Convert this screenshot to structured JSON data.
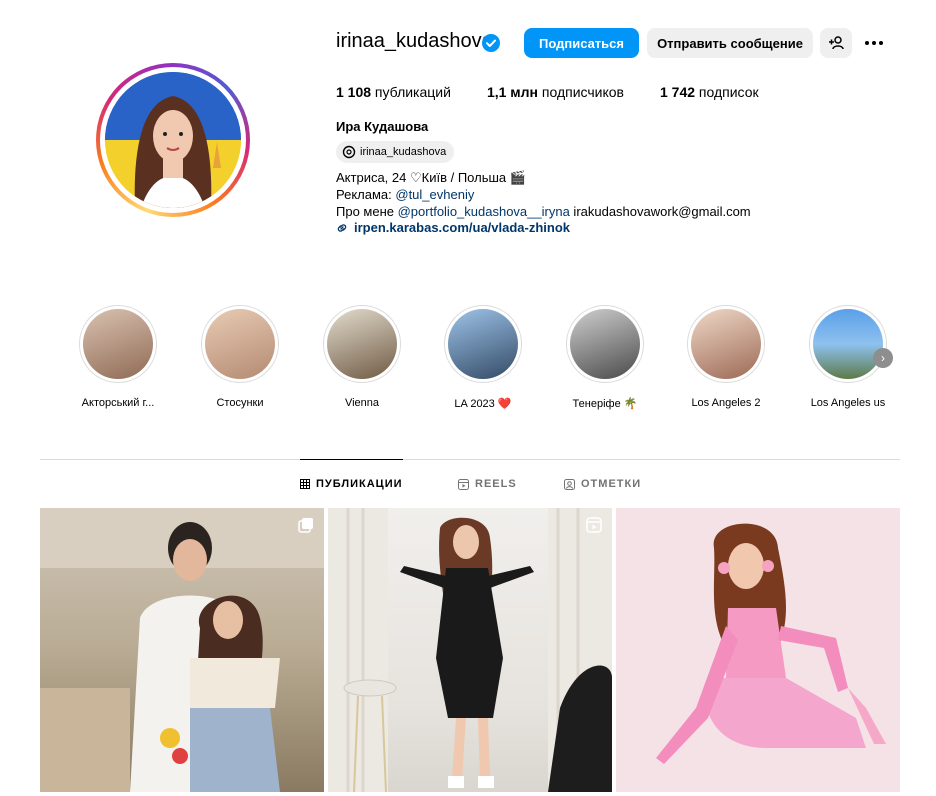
{
  "profile": {
    "username": "irinaa_kudashova",
    "full_name": "Ира Кудашова",
    "threads_handle": "irinaa_kudashova",
    "bio": {
      "line1": "Актриса, 24 ♡Київ / Польша 🎬",
      "line2_prefix": "Реклама: ",
      "line2_link": "@tul_evheniy",
      "line3_prefix": "Про мене ",
      "line3_link": "@portfolio_kudashova__iryna",
      "line3_suffix": " irakudashovawork@gmail.com"
    },
    "external_link": "irpen.karabas.com/ua/vlada-zhinok"
  },
  "actions": {
    "follow_label": "Подписаться",
    "message_label": "Отправить сообщение"
  },
  "stats": {
    "posts_count": "1 108",
    "posts_label": " публикаций",
    "followers_count": "1,1 млн",
    "followers_label": " подписчиков",
    "following_count": "1 742",
    "following_label": " подписок"
  },
  "highlights": [
    {
      "label": "Акторський г..."
    },
    {
      "label": "Стосунки"
    },
    {
      "label": "Vienna"
    },
    {
      "label": "LA 2023 ❤️"
    },
    {
      "label": "Тенеріфе 🌴"
    },
    {
      "label": "Los Angeles 2"
    },
    {
      "label": "Los Angeles us"
    }
  ],
  "tabs": {
    "posts": "ПУБЛИКАЦИИ",
    "reels": "REELS",
    "tagged": "ОТМЕТКИ"
  },
  "colors": {
    "accent": "#0095f6",
    "link": "#00376b",
    "button_gray": "#efefef",
    "divider": "#dbdbdb"
  }
}
